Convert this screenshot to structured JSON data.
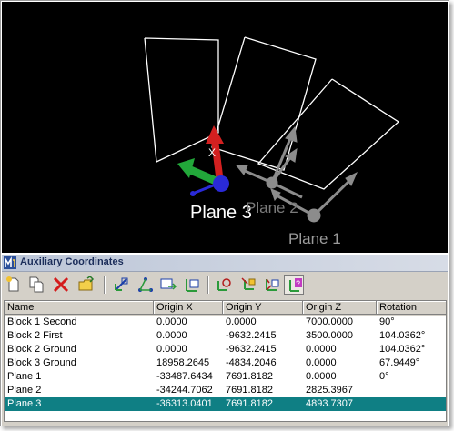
{
  "viewport": {
    "labels": {
      "plane3": "Plane 3",
      "plane2": "Plane 2",
      "plane1": "Plane 1"
    },
    "colors": {
      "background": "#000000",
      "outline": "#ffffff",
      "active_label": "#ffffff",
      "inactive_label": "#9a9a9a",
      "x_axis_active": "#d32020",
      "y_axis_active": "#22a83a",
      "z_axis_active": "#2a2ad8",
      "inactive_axis": "#8c8c8c"
    }
  },
  "panel": {
    "title": "Auxiliary Coordinates",
    "toolbar": [
      {
        "name": "new-icon",
        "pressed": false
      },
      {
        "name": "copy-icon",
        "pressed": false
      },
      {
        "name": "delete-icon",
        "pressed": false
      },
      {
        "name": "open-folder-icon",
        "pressed": false
      },
      {
        "name": "define-by-element-icon",
        "pressed": false
      },
      {
        "name": "define-by-points-icon",
        "pressed": false
      },
      {
        "name": "define-from-view-icon",
        "pressed": false
      },
      {
        "name": "define-from-active-icon",
        "pressed": false
      },
      {
        "name": "attach-to-element-icon",
        "pressed": false
      },
      {
        "name": "move-origin-icon",
        "pressed": false
      },
      {
        "name": "rotate-axes-icon",
        "pressed": false
      },
      {
        "name": "show-selected-icon",
        "pressed": true
      }
    ],
    "table": {
      "columns": [
        "Name",
        "Origin X",
        "Origin Y",
        "Origin Z",
        "Rotation"
      ],
      "rows": [
        [
          "Block 1 Second",
          "0.0000",
          "0.0000",
          "7000.0000",
          "90°"
        ],
        [
          "Block 2 First",
          "0.0000",
          "-9632.2415",
          "3500.0000",
          "104.0362°"
        ],
        [
          "Block 2 Ground",
          "0.0000",
          "-9632.2415",
          "0.0000",
          "104.0362°"
        ],
        [
          "Block 3 Ground",
          "18958.2645",
          "-4834.2046",
          "0.0000",
          "67.9449°"
        ],
        [
          "Plane 1",
          "-33487.6434",
          "7691.8182",
          "0.0000",
          "0°"
        ],
        [
          "Plane 2",
          "-34244.7062",
          "7691.8182",
          "2825.3967",
          ""
        ],
        [
          "Plane 3",
          "-36313.0401",
          "7691.8182",
          "4893.7307",
          ""
        ]
      ],
      "selected_row": "Plane 3",
      "selection_color": "#0f7f84"
    }
  }
}
